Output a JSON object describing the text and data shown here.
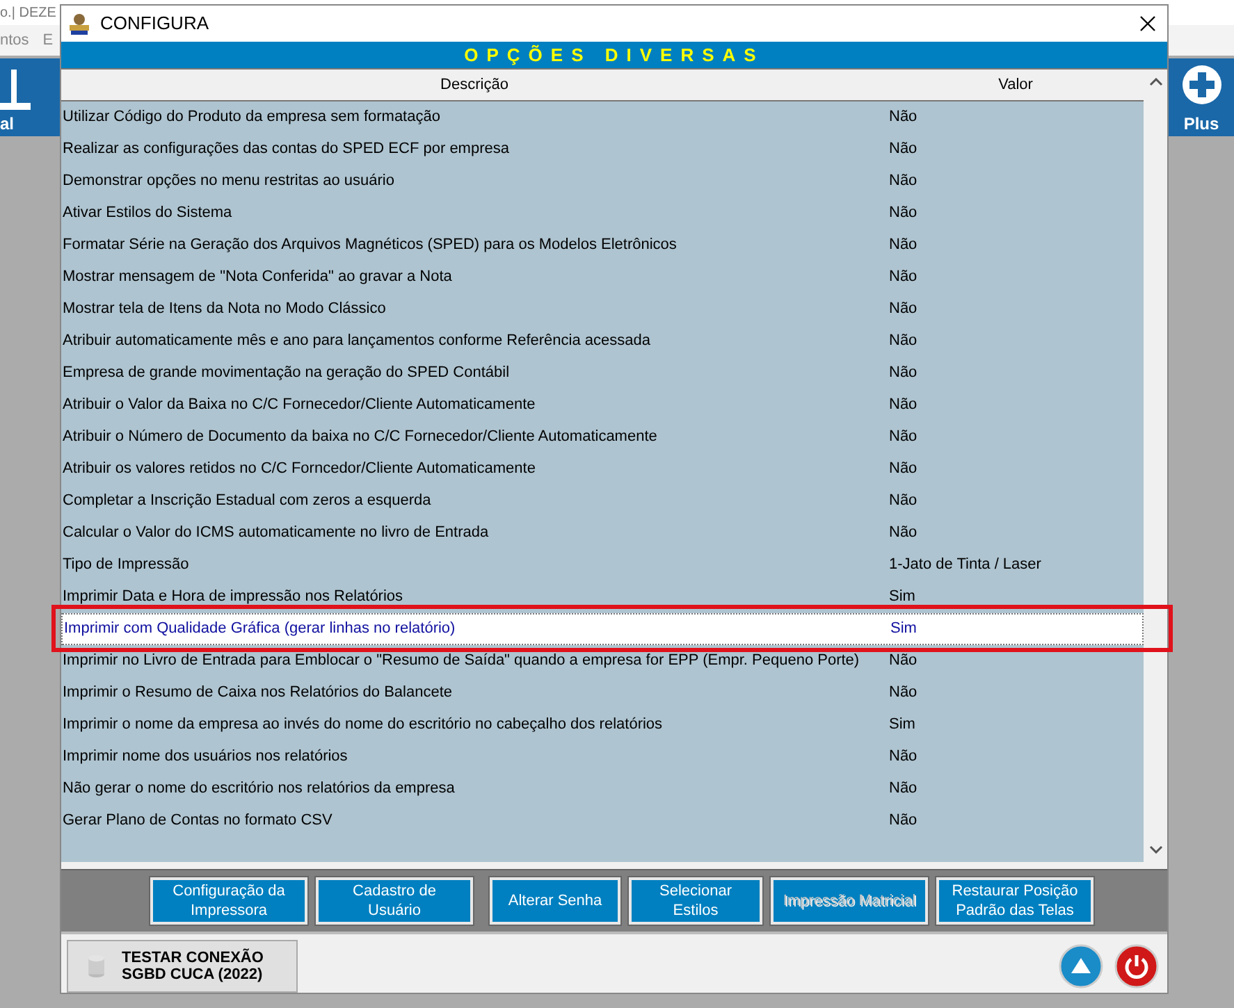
{
  "background_app": {
    "title": "o.| DEZE",
    "menu": [
      "ntos",
      "E"
    ],
    "left_tool": "al",
    "right_tool": "Plus"
  },
  "dialog": {
    "title": "CONFIGURA",
    "banner": "OPÇÕES DIVERSAS",
    "table": {
      "columns": [
        "Descrição",
        "Valor"
      ],
      "rows": [
        {
          "description": "Utilizar Código do Produto da empresa sem formatação",
          "value": "Não",
          "selected": false
        },
        {
          "description": "Realizar as configurações das contas do SPED ECF por empresa",
          "value": "Não",
          "selected": false
        },
        {
          "description": "Demonstrar opções no menu restritas ao usuário",
          "value": "Não",
          "selected": false
        },
        {
          "description": "Ativar Estilos do Sistema",
          "value": "Não",
          "selected": false
        },
        {
          "description": "Formatar Série na Geração dos Arquivos Magnéticos (SPED) para os Modelos Eletrônicos",
          "value": "Não",
          "selected": false
        },
        {
          "description": "Mostrar mensagem de \"Nota Conferida\" ao gravar a Nota",
          "value": "Não",
          "selected": false
        },
        {
          "description": "Mostrar tela de Itens da Nota no Modo Clássico",
          "value": "Não",
          "selected": false
        },
        {
          "description": "Atribuir automaticamente mês e ano para lançamentos conforme Referência acessada",
          "value": "Não",
          "selected": false
        },
        {
          "description": "Empresa de grande movimentação na geração do SPED Contábil",
          "value": "Não",
          "selected": false
        },
        {
          "description": "Atribuir o Valor da Baixa no C/C Fornecedor/Cliente Automaticamente",
          "value": "Não",
          "selected": false
        },
        {
          "description": "Atribuir o Número de Documento da baixa no C/C Fornecedor/Cliente Automaticamente",
          "value": "Não",
          "selected": false
        },
        {
          "description": "Atribuir os valores retidos no C/C Forncedor/Cliente Automaticamente",
          "value": "Não",
          "selected": false
        },
        {
          "description": "Completar a Inscrição Estadual com zeros a esquerda",
          "value": "Não",
          "selected": false
        },
        {
          "description": "Calcular o Valor do ICMS automaticamente no livro de Entrada",
          "value": "Não",
          "selected": false
        },
        {
          "description": "Tipo de Impressão",
          "value": "1-Jato de Tinta / Laser",
          "selected": false
        },
        {
          "description": "Imprimir Data e Hora de impressão nos Relatórios",
          "value": "Sim",
          "selected": false
        },
        {
          "description": "Imprimir com Qualidade Gráfica (gerar linhas no relatório)",
          "value": "Sim",
          "selected": true
        },
        {
          "description": "Imprimir no Livro de Entrada para Emblocar o \"Resumo de Saída\" quando a empresa for EPP (Empr. Pequeno Porte)",
          "value": "Não",
          "selected": false
        },
        {
          "description": "Imprimir o Resumo de Caixa nos Relatórios do Balancete",
          "value": "Não",
          "selected": false
        },
        {
          "description": "Imprimir o nome da empresa ao invés do nome do escritório no cabeçalho dos relatórios",
          "value": "Sim",
          "selected": false
        },
        {
          "description": "Imprimir nome dos usuários nos relatórios",
          "value": "Não",
          "selected": false
        },
        {
          "description": "Não gerar o nome do escritório nos relatórios da empresa",
          "value": "Não",
          "selected": false
        },
        {
          "description": "Gerar Plano de Contas no formato CSV",
          "value": "Não",
          "selected": false
        }
      ]
    },
    "buttons": [
      {
        "label": "Configuração da Impressora",
        "disabled": false
      },
      {
        "label": "Cadastro de Usuário",
        "disabled": false
      },
      {
        "label": "Alterar Senha",
        "disabled": false
      },
      {
        "label": "Selecionar Estilos",
        "disabled": false
      },
      {
        "label": "Impressão Matricial",
        "disabled": true
      },
      {
        "label": "Restaurar Posição Padrão das Telas",
        "disabled": false
      }
    ],
    "connection_button": "TESTAR CONEXÃO SGBD CUCA (2022)"
  }
}
